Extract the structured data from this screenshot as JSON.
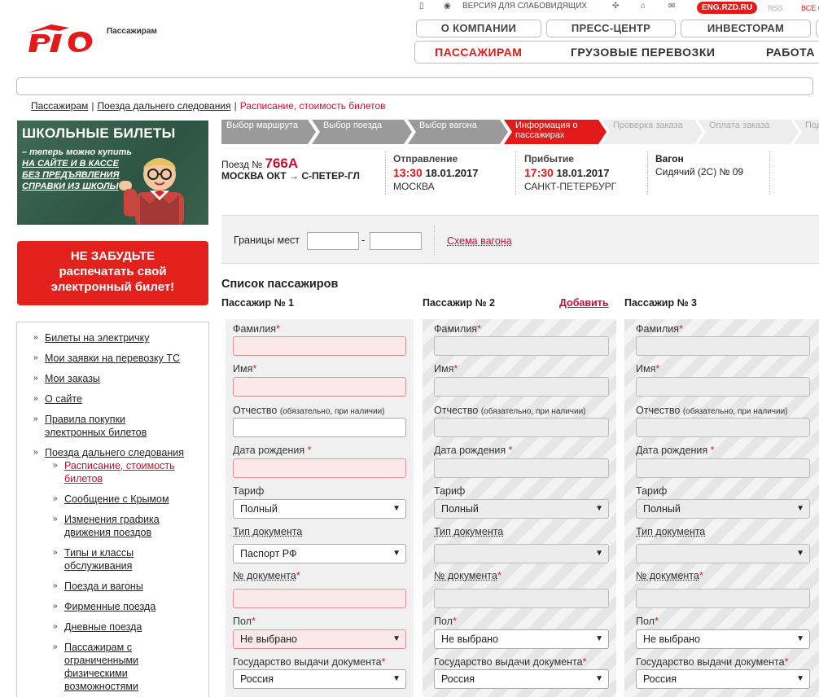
{
  "header": {
    "logo_text": "Пассажирам",
    "util": {
      "low_vision": "ВЕРСИЯ ДЛЯ СЛАБОВИДЯЩИХ",
      "eng": "ENG.RZD.RU",
      "rss": "RSS",
      "all": "ВСЕ С"
    },
    "top_nav": [
      "О КОМПАНИИ",
      "ПРЕСС-ЦЕНТР",
      "ИНВЕСТОРАМ"
    ],
    "main_nav": [
      "ПАССАЖИРАМ",
      "ГРУЗОВЫЕ ПЕРЕВОЗКИ",
      "РАБОТА"
    ]
  },
  "breadcrumb": [
    "Пассажирам",
    "Поезда дальнего следования",
    "Расписание, стоимость билетов"
  ],
  "banners": {
    "school_title": "ШКОЛЬНЫЕ БИЛЕТЫ",
    "school_lines": [
      "– теперь можно купить",
      "НА САЙТЕ И В КАССЕ",
      "БЕЗ ПРЕДЪЯВЛЕНИЯ",
      "СПРАВКИ ИЗ ШКОЛЫ"
    ],
    "print_lines": [
      "НЕ ЗАБУДЬТЕ",
      "распечатать свой",
      "электронный билет!"
    ]
  },
  "sidebar": {
    "items": [
      "Билеты на электричку",
      "Мои заявки на перевозку ТС",
      "Мои заказы",
      "О сайте",
      "Правила покупки электронных билетов",
      "Поезда дальнего следования"
    ],
    "subitems": [
      "Расписание, стоимость билетов",
      "Сообщение с Крымом",
      "Изменения графика движения поездов",
      "Типы и классы обслуживания",
      "Поезда и вагоны",
      "Фирменные поезда",
      "Дневные поезда",
      "Пассажирам с ограниченными физическими возможностями"
    ]
  },
  "steps": [
    "Выбор маршрута",
    "Выбор поезда",
    "Выбор вагона",
    "Информация о пассажирах",
    "Проверка заказа",
    "Оплата заказа",
    "Под"
  ],
  "train": {
    "label": "Поезд №",
    "number": "766А",
    "route": "МОСКВА ОКТ → С-ПЕТЕР-ГЛ",
    "departure_label": "Отправление",
    "departure_time": "13:30",
    "departure_date": "18.01.2017",
    "departure_city": "МОСКВА",
    "arrival_label": "Прибытие",
    "arrival_time": "17:30",
    "arrival_date": "18.01.2017",
    "arrival_city": "САНКТ-ПЕТЕРБУРГ",
    "car_label": "Вагон",
    "car_value": "Сидячий (2С) № 09"
  },
  "seats": {
    "label": "Границы мест",
    "from": "",
    "to": "",
    "dash": "-",
    "scheme_link": "Схема вагона"
  },
  "passengers": {
    "title": "Список пассажиров",
    "add": "Добавить",
    "p1_title": "Пассажир № 1",
    "p2_title": "Пассажир № 2",
    "p3_title": "Пассажир № 3",
    "surname": "Фамилия",
    "name": "Имя",
    "patronymic": "Отчество",
    "patronymic_note": "(обязательно, при наличии)",
    "birth": "Дата рождения",
    "tariff": "Тариф",
    "doc_type": "Тип документа",
    "doc_number": "№ документа",
    "gender": "Пол",
    "country": "Государство выдачи документа",
    "req": "*",
    "arrow": "▼",
    "p1": {
      "tariff": "Полный",
      "doc_type": "Паспорт РФ",
      "gender": "Не выбрано",
      "country": "Россия"
    },
    "p2": {
      "tariff": "Полный",
      "doc_type": "",
      "gender": "Не выбрано",
      "country": "Россия"
    },
    "p3": {
      "tariff": "Полный",
      "doc_type": "",
      "gender": "Не выбрано",
      "country": "Россия"
    }
  }
}
